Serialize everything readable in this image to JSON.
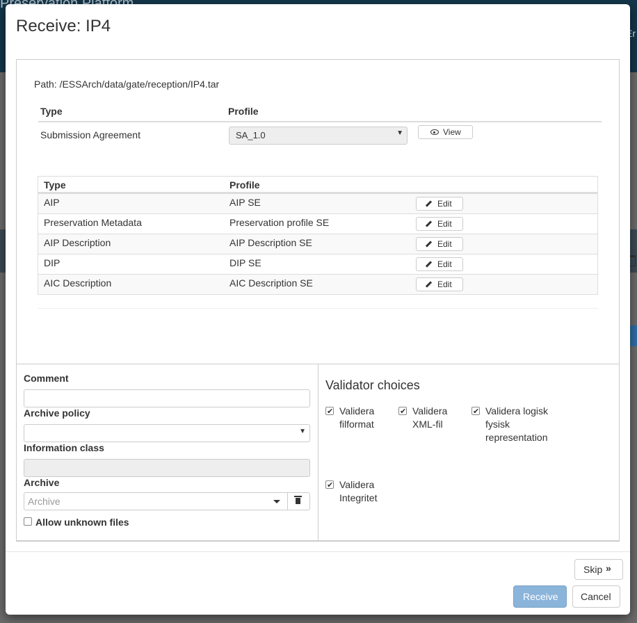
{
  "background": {
    "header_title": "Preservation Platform",
    "header_right": "Er"
  },
  "modal": {
    "title": "Receive: IP4",
    "path": "Path: /ESSArch/data/gate/reception/IP4.tar",
    "sa_table": {
      "headers": [
        "Type",
        "Profile"
      ],
      "row": {
        "type": "Submission Agreement",
        "profile": "SA_1.0",
        "view_label": "View"
      }
    },
    "profile_table": {
      "headers": [
        "Type",
        "Profile"
      ],
      "edit_label": "Edit",
      "rows": [
        {
          "type": "AIP",
          "profile": "AIP SE"
        },
        {
          "type": "Preservation Metadata",
          "profile": "Preservation profile SE"
        },
        {
          "type": "AIP Description",
          "profile": "AIP Description SE"
        },
        {
          "type": "DIP",
          "profile": "DIP SE"
        },
        {
          "type": "AIC Description",
          "profile": "AIC Description SE"
        }
      ]
    },
    "form": {
      "comment_label": "Comment",
      "comment_value": "",
      "archive_policy_label": "Archive policy",
      "information_class_label": "Information class",
      "archive_label": "Archive",
      "archive_placeholder": "Archive",
      "allow_unknown_label": "Allow unknown files"
    },
    "validators": {
      "title": "Validator choices",
      "items": [
        {
          "label": "Validera filformat",
          "checked": true
        },
        {
          "label": "Validera XML-fil",
          "checked": true
        },
        {
          "label": "Validera logisk fysisk representation",
          "checked": true
        },
        {
          "label": "Validera Integritet",
          "checked": true
        }
      ]
    },
    "buttons": {
      "skip": "Skip",
      "receive": "Receive",
      "cancel": "Cancel"
    }
  }
}
